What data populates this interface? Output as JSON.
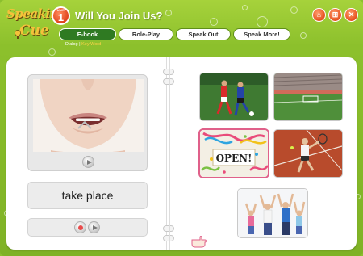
{
  "header": {
    "logo_line1": "Speaking",
    "logo_line2": "Cue",
    "unit_label": "UNIT",
    "unit_number": "1",
    "title": "Will You Join Us?"
  },
  "top_icons": [
    {
      "name": "home-icon",
      "glyph": "⌂"
    },
    {
      "name": "menu-icon",
      "glyph": "⊞"
    },
    {
      "name": "close-icon",
      "glyph": "✕"
    }
  ],
  "tabs": [
    {
      "label": "E-book",
      "active": true
    },
    {
      "label": "Role-Play",
      "active": false
    },
    {
      "label": "Speak Out",
      "active": false
    },
    {
      "label": "Speak More!",
      "active": false
    }
  ],
  "subnav": {
    "dialog": "Dialog",
    "separator": " | ",
    "key_word": "Key Word"
  },
  "left_page": {
    "word": "take place"
  },
  "right_page": {
    "open_card_text": "OPEN!"
  },
  "colors": {
    "frame_green": "#8cc02c",
    "active_tab": "#2f7a22",
    "accent_orange": "#e5501f",
    "selection_pink": "#e0608a"
  }
}
